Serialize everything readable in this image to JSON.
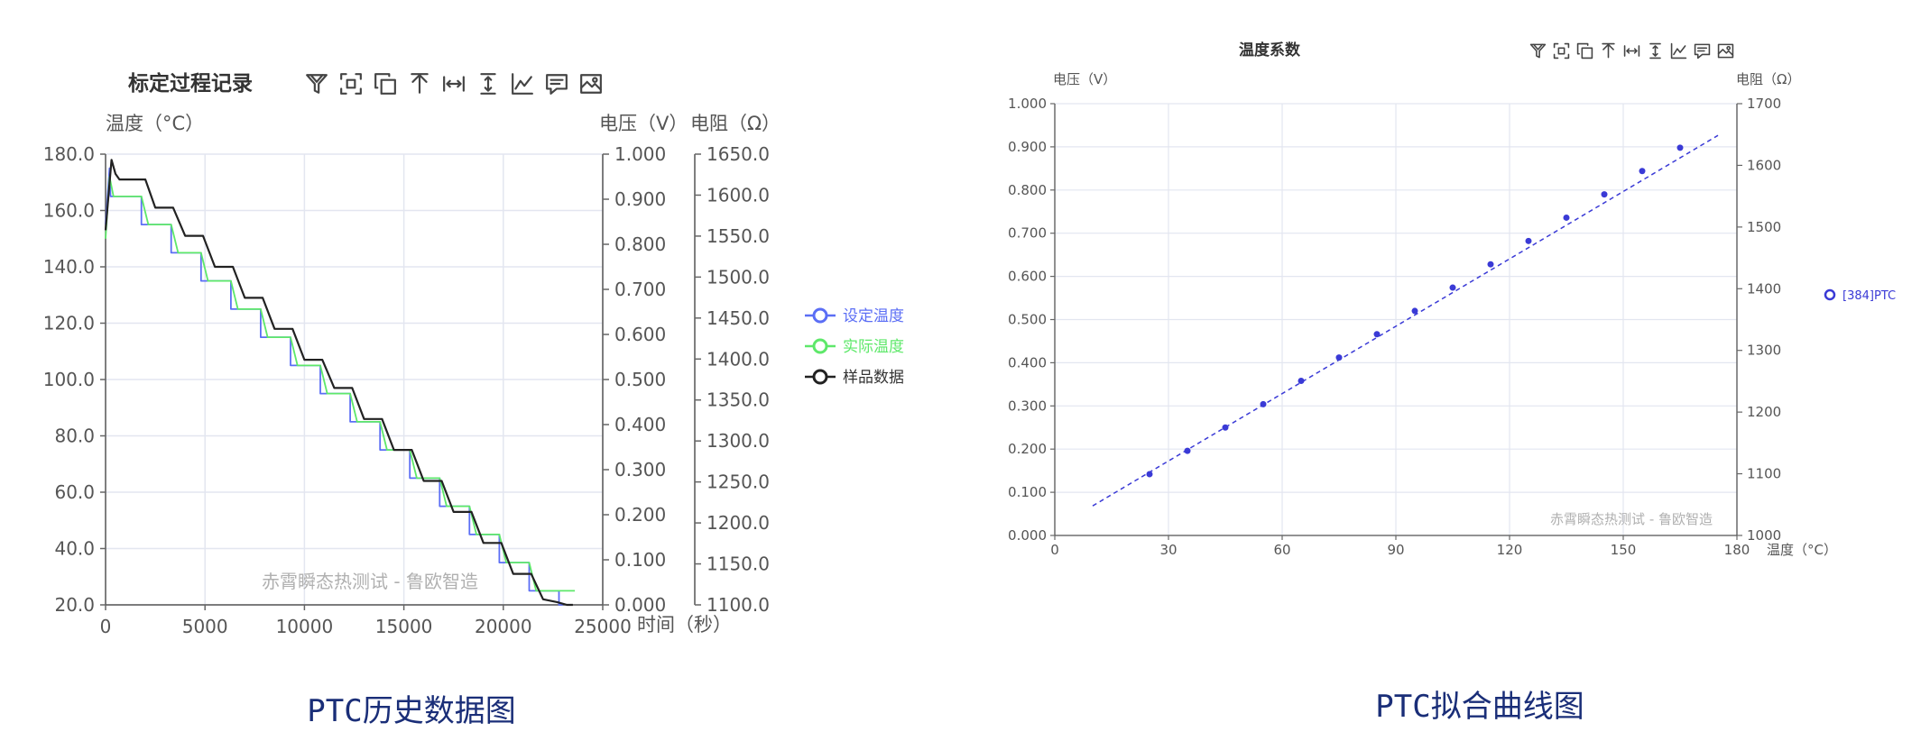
{
  "chart_data": [
    {
      "type": "line",
      "title": "标定过程记录",
      "xlabel": "时间（秒）",
      "ylabel_left": "温度（°C）",
      "ylabel_right1": "电压（V）",
      "ylabel_right2": "电阻（Ω）",
      "xlim": [
        0,
        25000
      ],
      "ylim_left": [
        20,
        180
      ],
      "ylim_right1": [
        0,
        1
      ],
      "ylim_right2": [
        1100,
        1650
      ],
      "x_ticks": [
        "0",
        "5000",
        "10000",
        "15000",
        "20000",
        "25000"
      ],
      "y_ticks_left": [
        "20.0",
        "40.0",
        "60.0",
        "80.0",
        "100.0",
        "120.0",
        "140.0",
        "160.0",
        "180.0"
      ],
      "y_ticks_right1": [
        "0.000",
        "0.100",
        "0.200",
        "0.300",
        "0.400",
        "0.500",
        "0.600",
        "0.700",
        "0.800",
        "0.900",
        "1.000"
      ],
      "y_ticks_right2": [
        "1100.0",
        "1150.0",
        "1200.0",
        "1250.0",
        "1300.0",
        "1350.0",
        "1400.0",
        "1450.0",
        "1500.0",
        "1550.0",
        "1600.0",
        "1650.0"
      ],
      "grid": true,
      "legend_position": "right",
      "watermark": "赤霄瞬态热测试 - 鲁欧智造",
      "series": [
        {
          "name": "设定温度",
          "color": "#5b6ef5",
          "x": [
            0,
            200,
            250,
            1800,
            1800,
            3300,
            3300,
            4800,
            4800,
            6300,
            6300,
            7800,
            7800,
            9300,
            9300,
            10800,
            10800,
            12300,
            12300,
            13800,
            13800,
            15300,
            15300,
            16800,
            16800,
            18300,
            18300,
            19800,
            19800,
            21300,
            21300,
            22800,
            22800,
            23000
          ],
          "y": [
            155,
            175,
            165,
            165,
            155,
            155,
            145,
            145,
            135,
            135,
            125,
            125,
            115,
            115,
            105,
            105,
            95,
            95,
            85,
            85,
            75,
            75,
            65,
            65,
            55,
            55,
            45,
            45,
            35,
            35,
            25,
            25,
            20,
            20
          ]
        },
        {
          "name": "实际温度",
          "color": "#5ee86a",
          "x": [
            0,
            200,
            400,
            1800,
            2150,
            3300,
            3650,
            4800,
            5150,
            6300,
            6650,
            7800,
            8150,
            9300,
            9650,
            10800,
            11150,
            12300,
            12650,
            13800,
            14150,
            15300,
            15650,
            16800,
            17150,
            18300,
            18650,
            19800,
            20150,
            21300,
            21650,
            22800,
            23150,
            23600
          ],
          "y": [
            150,
            172,
            165,
            165,
            155,
            155,
            145,
            145,
            135,
            135,
            125,
            125,
            115,
            115,
            105,
            105,
            95,
            95,
            85,
            85,
            75,
            75,
            65,
            65,
            55,
            55,
            45,
            45,
            35,
            35,
            25,
            25,
            25,
            25
          ]
        },
        {
          "name": "样品数据",
          "color": "#222222",
          "x": [
            0,
            300,
            500,
            700,
            2000,
            2500,
            3400,
            4000,
            4900,
            5500,
            6400,
            7000,
            7900,
            8500,
            9400,
            10000,
            10900,
            11500,
            12400,
            13000,
            13900,
            14500,
            15400,
            16000,
            16900,
            17500,
            18400,
            19000,
            19900,
            20500,
            21400,
            22000,
            22700,
            23200,
            23500
          ],
          "y": [
            153,
            178,
            173,
            171,
            171,
            161,
            161,
            151,
            151,
            140,
            140,
            129,
            129,
            118,
            118,
            107,
            107,
            97,
            97,
            86,
            86,
            75,
            75,
            64,
            64,
            53,
            53,
            42,
            42,
            31,
            31,
            22,
            21,
            20,
            20
          ]
        }
      ]
    },
    {
      "type": "scatter",
      "title": "温度系数",
      "xlabel": "温度（°C）",
      "ylabel_left": "电压（V）",
      "ylabel_right": "电阻（Ω）",
      "xlim": [
        0,
        180
      ],
      "ylim_left": [
        0,
        1
      ],
      "ylim_right": [
        1000,
        1700
      ],
      "x_ticks": [
        "0",
        "30",
        "60",
        "90",
        "120",
        "150",
        "180"
      ],
      "y_ticks_left": [
        "0.000",
        "0.100",
        "0.200",
        "0.300",
        "0.400",
        "0.500",
        "0.600",
        "0.700",
        "0.800",
        "0.900",
        "1.000"
      ],
      "y_ticks_right": [
        "1000",
        "1100",
        "1200",
        "1300",
        "1400",
        "1500",
        "1600",
        "1700"
      ],
      "grid": true,
      "legend_position": "right",
      "watermark": "赤霄瞬态热测试 - 鲁欧智造",
      "series": [
        {
          "name": "[384]PTC",
          "color": "#3a3ad6",
          "x": [
            25,
            35,
            45,
            55,
            65,
            75,
            85,
            95,
            105,
            115,
            125,
            135,
            145,
            155,
            165
          ],
          "y": [
            0.142,
            0.196,
            0.25,
            0.304,
            0.358,
            0.412,
            0.466,
            0.52,
            0.574,
            0.628,
            0.682,
            0.736,
            0.79,
            0.844,
            0.898
          ],
          "fit_x": [
            10,
            175
          ],
          "fit_y": [
            0.0685,
            0.9265
          ]
        }
      ]
    }
  ],
  "captions": {
    "left": "PTC历史数据图",
    "right": "PTC拟合曲线图"
  },
  "toolbox": [
    "filter-icon",
    "zoom-area-icon",
    "copy-icon",
    "upload-icon",
    "fit-width-icon",
    "fit-height-icon",
    "line-chart-icon",
    "comment-icon",
    "save-image-icon"
  ]
}
